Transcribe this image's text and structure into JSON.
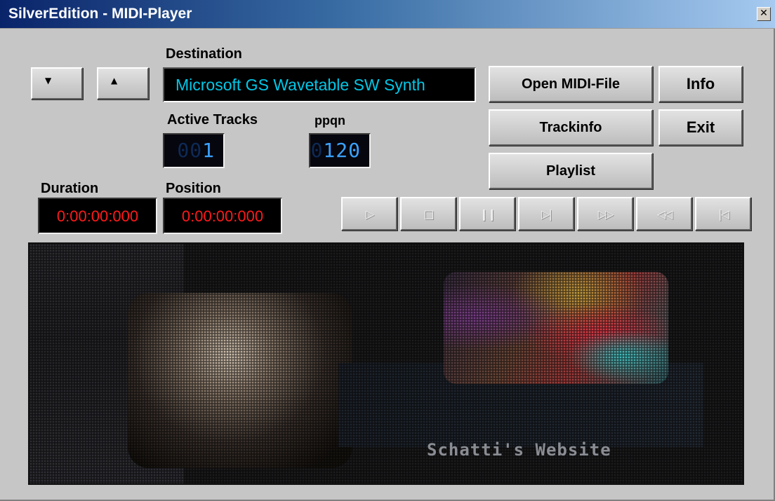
{
  "window": {
    "title": "SilverEdition - MIDI-Player",
    "close_glyph": "✕"
  },
  "controls": {
    "destination_label": "Destination",
    "destination_value": "Microsoft GS Wavetable SW Synth",
    "prev_glyph": "▼",
    "next_glyph": "▲",
    "active_tracks_label": "Active Tracks",
    "active_tracks_dim": "00",
    "active_tracks_value": "1",
    "ppqn_label": "ppqn",
    "ppqn_dim": "0",
    "ppqn_value": "120",
    "duration_label": "Duration",
    "duration_value": "0:00:00:000",
    "position_label": "Position",
    "position_value": "0:00:00:000"
  },
  "buttons": {
    "open": "Open MIDI-File",
    "info": "Info",
    "trackinfo": "Trackinfo",
    "exit": "Exit",
    "playlist": "Playlist"
  },
  "transport": [
    {
      "name": "play-button",
      "glyph": "▷"
    },
    {
      "name": "stop-button",
      "glyph": "□"
    },
    {
      "name": "pause-button",
      "glyph": "❙❙"
    },
    {
      "name": "next-track-button",
      "glyph": "▷|"
    },
    {
      "name": "fast-forward-button",
      "glyph": "▷▷"
    },
    {
      "name": "rewind-button",
      "glyph": "◁◁"
    },
    {
      "name": "first-track-button",
      "glyph": "|◁"
    }
  ],
  "banner": {
    "caption": "Schatti's Website"
  },
  "colors": {
    "destination_text": "#00c8e8",
    "lcd_digits": "#3aa2ff",
    "time_digits": "#ff1a1a",
    "title_bar": "#0a246a"
  }
}
